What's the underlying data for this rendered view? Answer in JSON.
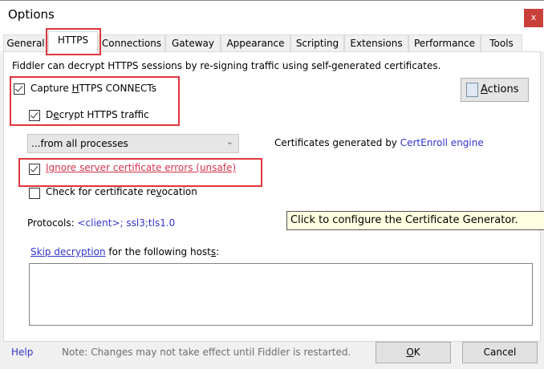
{
  "window": {
    "title": "Options",
    "close_label": "x"
  },
  "tabs": [
    {
      "label": "General"
    },
    {
      "label": "HTTPS",
      "selected": true
    },
    {
      "label": "Connections"
    },
    {
      "label": "Gateway"
    },
    {
      "label": "Appearance"
    },
    {
      "label": "Scripting"
    },
    {
      "label": "Extensions"
    },
    {
      "label": "Performance"
    },
    {
      "label": "Tools"
    }
  ],
  "https": {
    "intro": "Fiddler can decrypt HTTPS sessions by re-signing traffic using self-generated certificates.",
    "capture_connects": {
      "label_pre": "Capture ",
      "label_u": "H",
      "label_post": "TTPS CONNECTs",
      "checked": true
    },
    "decrypt_traffic": {
      "label_pre": "D",
      "label_u": "e",
      "label_post": "crypt HTTPS traffic",
      "checked": true
    },
    "actions_button": {
      "label_u": "A",
      "label_post": "ctions"
    },
    "process_filter": {
      "selected": "...from all processes"
    },
    "cert_generated_prefix": "Certificates generated by ",
    "cert_engine_link": "CertEnroll engine",
    "ignore_errors": {
      "label_u": "I",
      "label_post": "gnore server certificate errors (unsafe)",
      "checked": true
    },
    "check_revocation": {
      "label_pre": "Check for certificate re",
      "label_u": "v",
      "label_post": "ocation",
      "checked": false
    },
    "protocols_label": "Protocols: ",
    "protocols_value": "<client>; ssl3;tls1.0",
    "tooltip": "Click to configure the Certificate Generator.",
    "skip_link": "Skip decryption",
    "skip_text_pre": " for the following host",
    "skip_text_u": "s",
    "skip_text_post": ":",
    "hosts_value": ""
  },
  "footer": {
    "help": "Help",
    "note": "Note: Changes may not take effect until Fiddler is restarted.",
    "ok_u": "O",
    "ok_post": "K",
    "cancel": "Cancel"
  },
  "colors": {
    "highlight": "#e0353b",
    "link": "#3333cc",
    "warning": "#d3334d"
  }
}
